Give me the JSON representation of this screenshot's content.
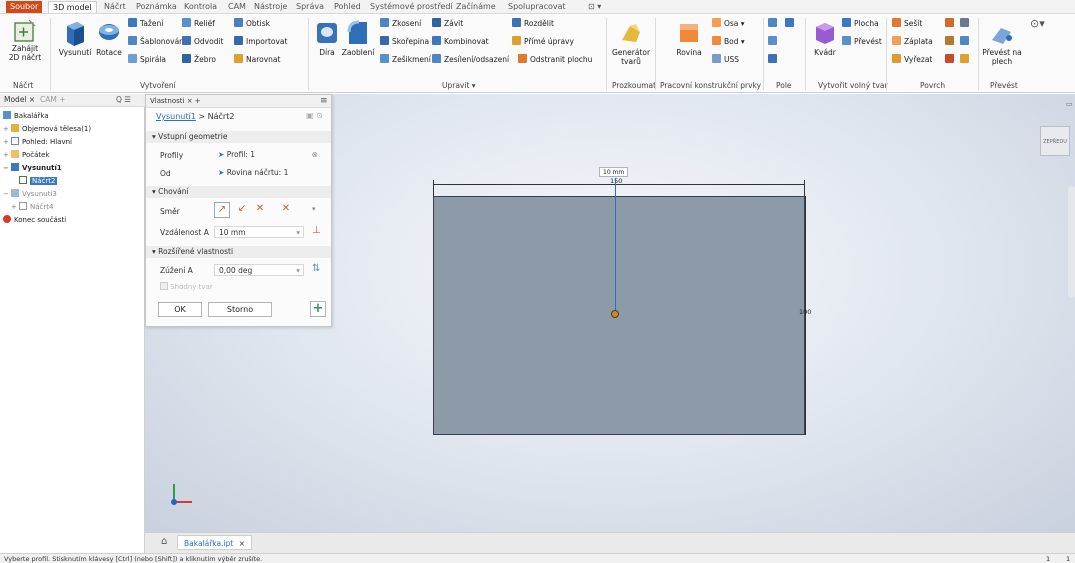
{
  "menu": {
    "tabs": [
      "Soubor",
      "3D model",
      "Náčrt",
      "Poznámka",
      "Kontrola",
      "CAM",
      "Nástroje",
      "Správa",
      "Pohled",
      "Systémové prostředí",
      "Začínáme",
      "Spolupracovat"
    ],
    "active_tab": "3D model",
    "extra": "⊡ ▾"
  },
  "ribbon": {
    "sketch": {
      "start_label": "Zahájit",
      "start_label2": "2D náčrt",
      "panel": "Náčrt"
    },
    "create": {
      "extrude": "Vysunutí",
      "revolve": "Rotace",
      "sweep": "Tažení",
      "loft": "Šablonování",
      "coil": "Spirála",
      "emboss": "Reliéf",
      "derive": "Odvodit",
      "rib": "Žebro",
      "decal": "Obtisk",
      "import": "Importovat",
      "unwrap": "Narovnat",
      "panel": "Vytvoření"
    },
    "modify": {
      "hole": "Díra",
      "fillet": "Zaoblení",
      "chamfer": "Zkosení",
      "shell": "Skořepina",
      "draft": "Zešikmení",
      "thread": "Závit",
      "combine": "Kombinovat",
      "thicken": "Zesílení/odsazení",
      "split": "Rozdělit",
      "direct": "Přímé úpravy",
      "delete_face": "Odstranit plochu",
      "panel": "Upravit ▾"
    },
    "explore": {
      "shape_gen": "Generátor",
      "shape_gen2": "tvarů",
      "panel": "Prozkoumat"
    },
    "work_features": {
      "plane": "Rovina",
      "axis": "Osa ▾",
      "point": "Bod ▾",
      "ucs": "USS",
      "panel": "Pracovní konstrukční prvky"
    },
    "pattern": {
      "panel": "Pole"
    },
    "freeform": {
      "box": "Kvádr",
      "panel": "Vytvořit volný tvar"
    },
    "surface": {
      "face": "Plocha",
      "convert": "Převést",
      "stitch": "Sešít",
      "patch": "Záplata",
      "trim": "Vyřezat",
      "panel": "Povrch"
    },
    "convert": {
      "sheet": "Převést na",
      "sheet2": "plech",
      "panel": "Převést"
    }
  },
  "browser": {
    "tab_model": "Model",
    "tab_cam": "CAM",
    "items": [
      {
        "label": "Bakalářka",
        "bold": false
      },
      {
        "label": "Objemová tělesa(1)",
        "bold": false
      },
      {
        "label": "Pohled: Hlavní",
        "bold": false
      },
      {
        "label": "Počátek",
        "bold": false
      },
      {
        "label": "Vysunutí1",
        "bold": true
      },
      {
        "label": "Náčrt2",
        "bold": false
      },
      {
        "label": "Vysunutí3",
        "bold": false
      },
      {
        "label": "Náčrt4",
        "bold": false
      },
      {
        "label": "Konec součásti",
        "bold": false
      }
    ]
  },
  "properties": {
    "tab_title": "Vlastnosti",
    "breadcrumb_feature": "Vysunutí1",
    "breadcrumb_sep": ">",
    "breadcrumb_sketch": "Náčrt2",
    "section_input": "▾ Vstupní geometrie",
    "profiles_label": "Profily",
    "profiles_value": "Profil: 1",
    "from_label": "Od",
    "from_value": "Rovina náčrtu: 1",
    "section_behavior": "▾ Chování",
    "direction_label": "Směr",
    "distance_label": "Vzdálenost A",
    "distance_value": "10 mm",
    "section_advanced": "▾ Rozšířené vlastnosti",
    "taper_label": "Zúžení A",
    "taper_value": "0,00 deg",
    "match_shape": "Shodný tvar",
    "ok": "OK",
    "cancel": "Storno"
  },
  "viewport": {
    "dim_width": "150",
    "dim_height": "100",
    "distance_tag": "10 mm",
    "viewcube_label": "ZEPŘEDU"
  },
  "document_tab": {
    "name": "Bakalářka.ipt",
    "close": "×"
  },
  "status": {
    "text": "Vyberte profil. Stisknutím klávesy [Ctrl] (nebo [Shift]) a kliknutím výběr zrušíte.",
    "count1": "1",
    "count2": "1"
  }
}
